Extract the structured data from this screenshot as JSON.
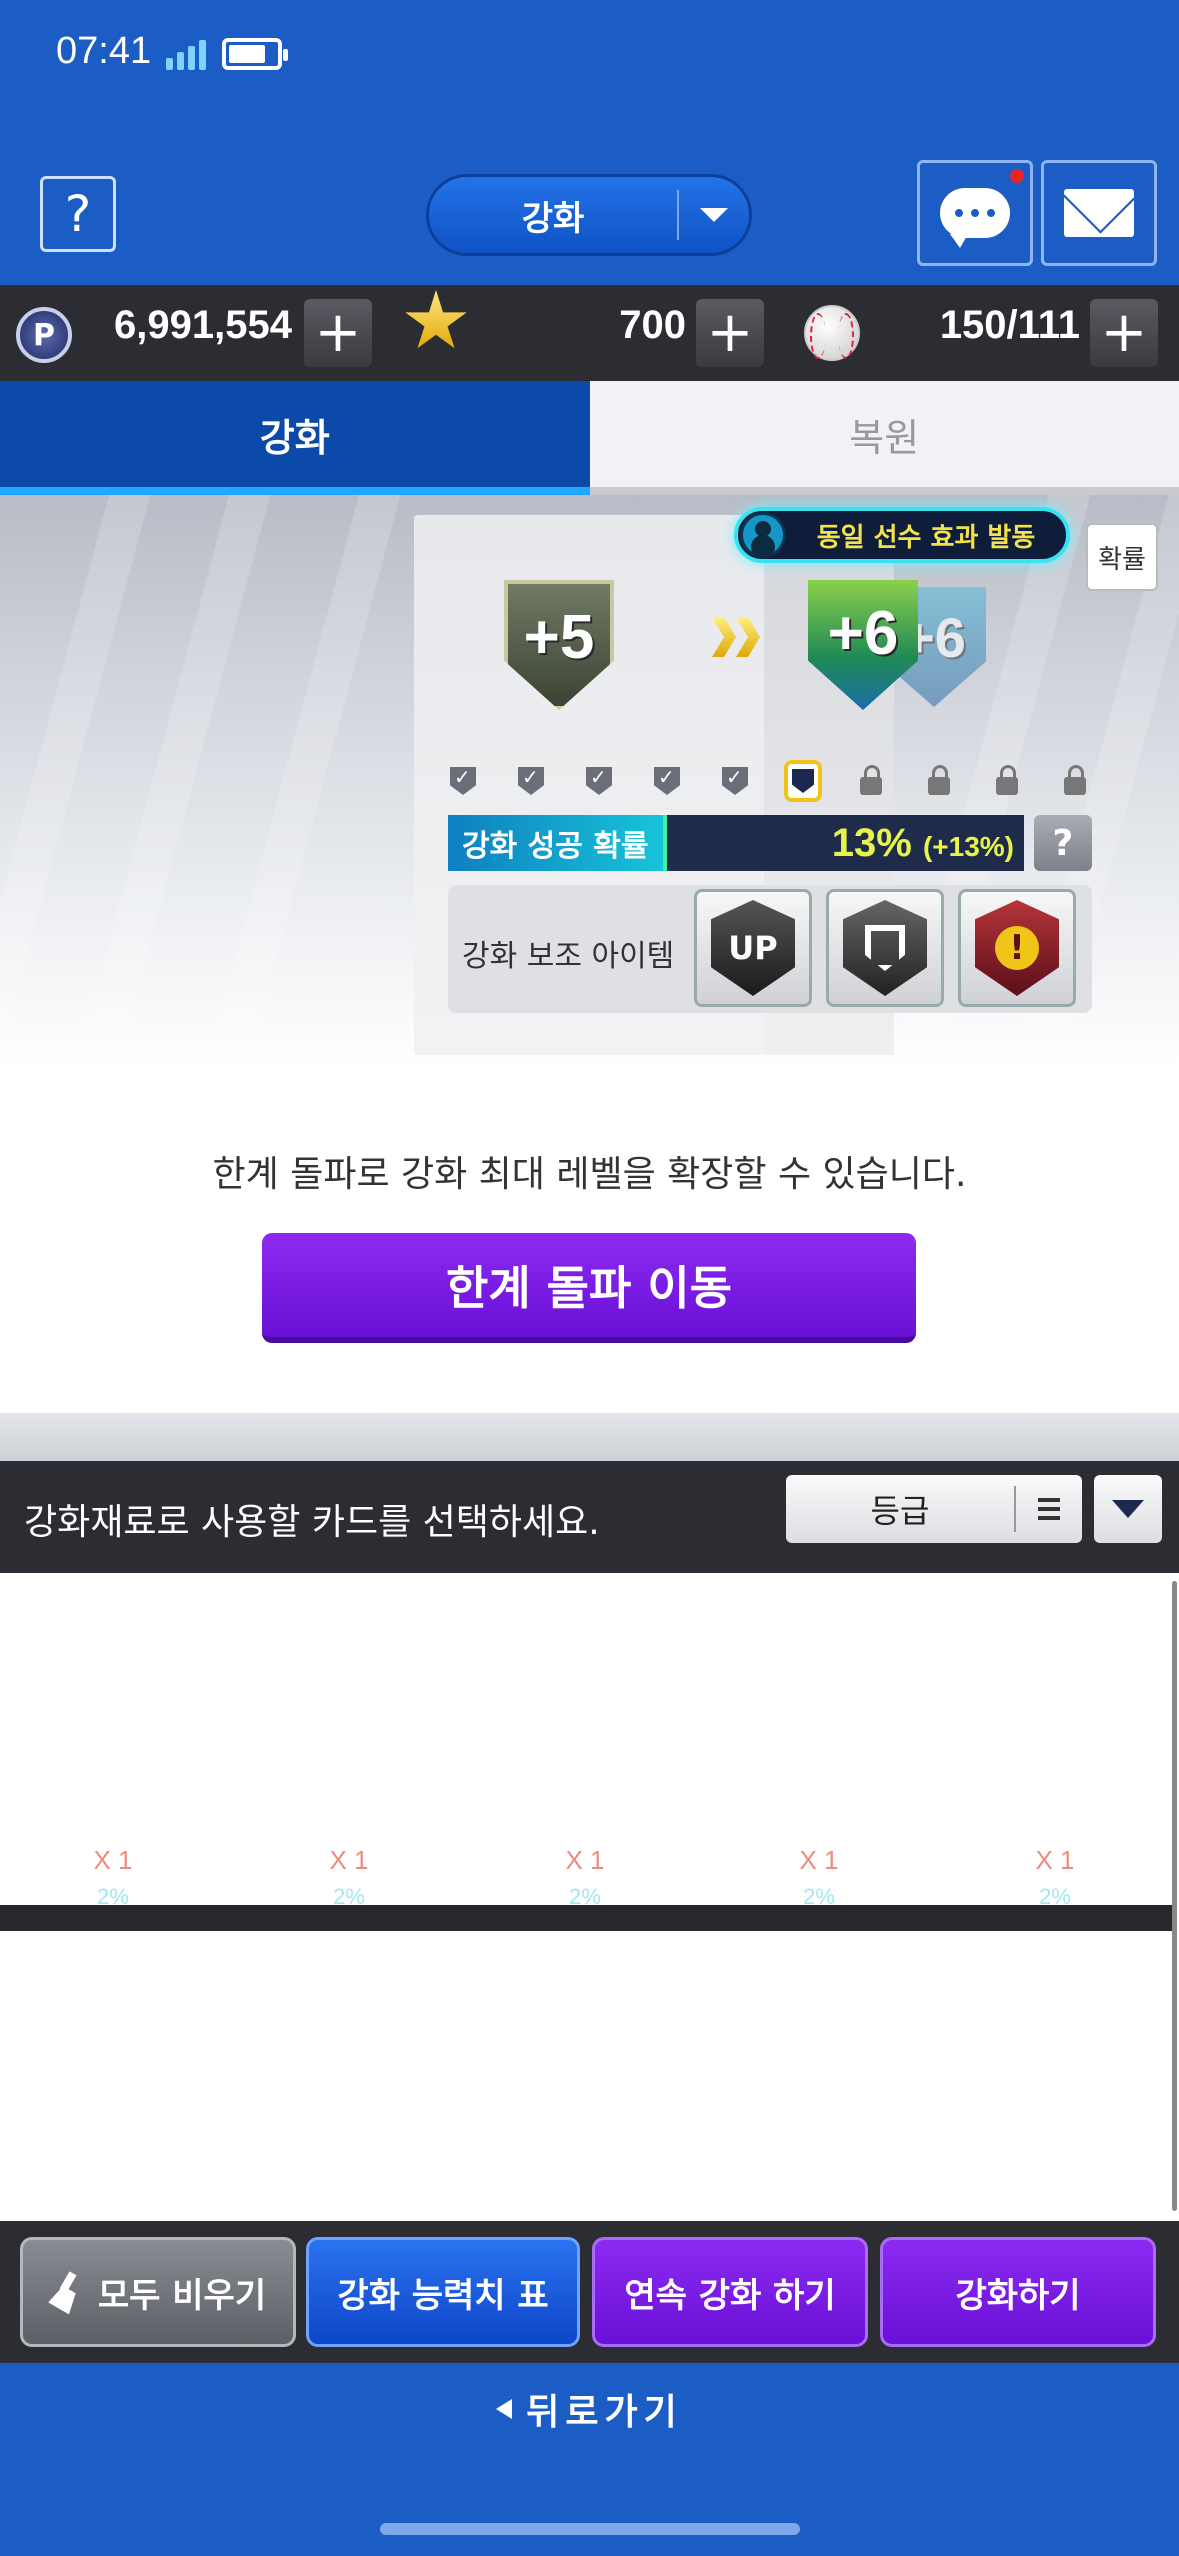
{
  "status_bar": {
    "time": "07:41"
  },
  "header": {
    "help_label": "?",
    "mode_select": {
      "label": "강화"
    },
    "chat_icon": "chat-icon",
    "mail_icon": "mail-icon",
    "chat_has_notification": true
  },
  "currency": {
    "points": "6,991,554",
    "stars": "700",
    "balls": "150/111",
    "plus_label": "+",
    "points_icon_label": "P"
  },
  "tabs": [
    {
      "label": "강화",
      "active": true
    },
    {
      "label": "복원",
      "active": false
    }
  ],
  "upgrade": {
    "same_player_effect": "동일 선수 효과 발동",
    "probability_button": "확률",
    "current_level": "+5",
    "next_level": "+6",
    "ghost_level": "+6",
    "level_slots": {
      "completed": 5,
      "current": 1,
      "locked": 4
    },
    "success_label": "강화 성공 확률",
    "success_value": "13%",
    "success_bonus": "(+13%)",
    "success_fill": 0.38,
    "help_label": "?",
    "assist_label": "강화 보조 아이템",
    "assist_items": [
      {
        "icon": "up-badge-icon",
        "text": "UP"
      },
      {
        "icon": "guard-shield-icon",
        "text": ""
      },
      {
        "icon": "warning-badge-icon",
        "text": "!"
      }
    ]
  },
  "limit_break": {
    "description": "한계 돌파로 강화 최대 레벨을 확장할 수 있습니다.",
    "button_label": "한계 돌파 이동"
  },
  "materials": {
    "title": "강화재료로 사용할 카드를 선택하세요.",
    "sort_label": "등급",
    "cells": [
      {
        "qty": "X 1",
        "pct": "2%"
      },
      {
        "qty": "X 1",
        "pct": "2%"
      },
      {
        "qty": "X 1",
        "pct": "2%"
      },
      {
        "qty": "X 1",
        "pct": "2%"
      },
      {
        "qty": "X 1",
        "pct": "2%"
      }
    ]
  },
  "actions": {
    "clear_label": "모두 비우기",
    "table_label": "강화 능력치 표",
    "continuous_label": "연속 강화 하기",
    "upgrade_label": "강화하기"
  },
  "back": {
    "label": "뒤로가기"
  },
  "colors": {
    "header_blue": "#1b5dc4",
    "purple_button": "#7a18e6",
    "success_value": "#e7f548",
    "same_player_glow": "#38e2f0"
  }
}
